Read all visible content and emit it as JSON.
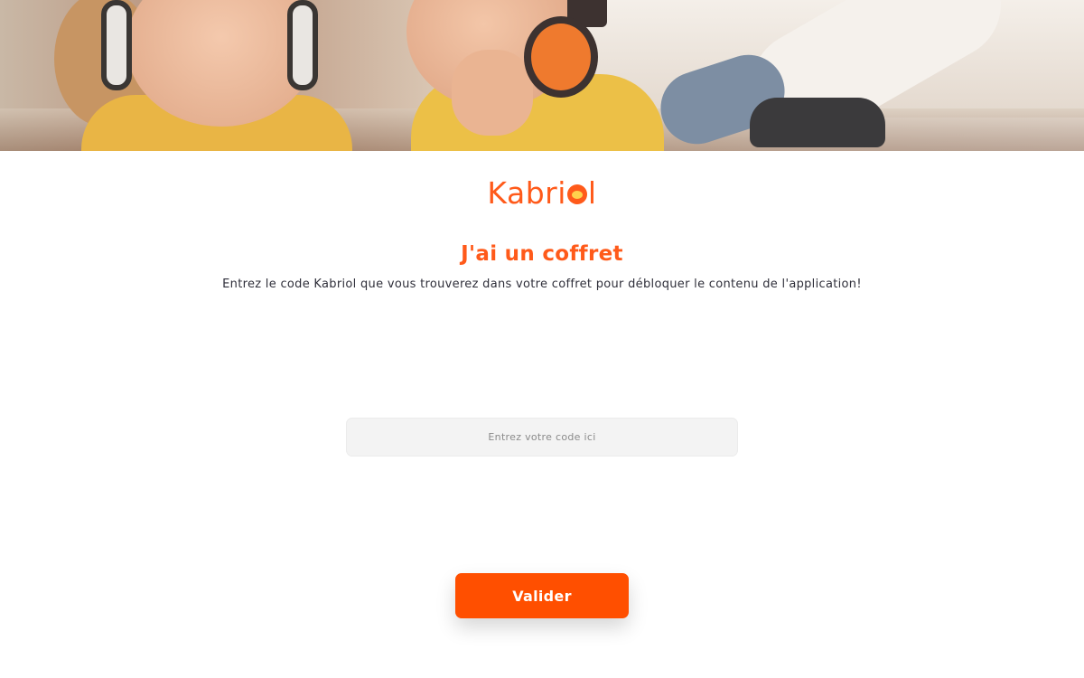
{
  "brand": {
    "logo_prefix": "Kabri",
    "logo_suffix": "l",
    "mascot_icon": "bird-mascot-icon",
    "accent_color": "#ff5a1a"
  },
  "hero": {
    "image": "children-with-headphones-photo"
  },
  "main": {
    "title": "J'ai un coffret",
    "subtitle": "Entrez le code Kabriol que vous trouverez dans votre coffret pour débloquer le contenu de l'application!"
  },
  "form": {
    "code_value": "",
    "code_placeholder": "Entrez votre code ici",
    "submit_label": "Valider",
    "button_color": "#ff4f00"
  }
}
